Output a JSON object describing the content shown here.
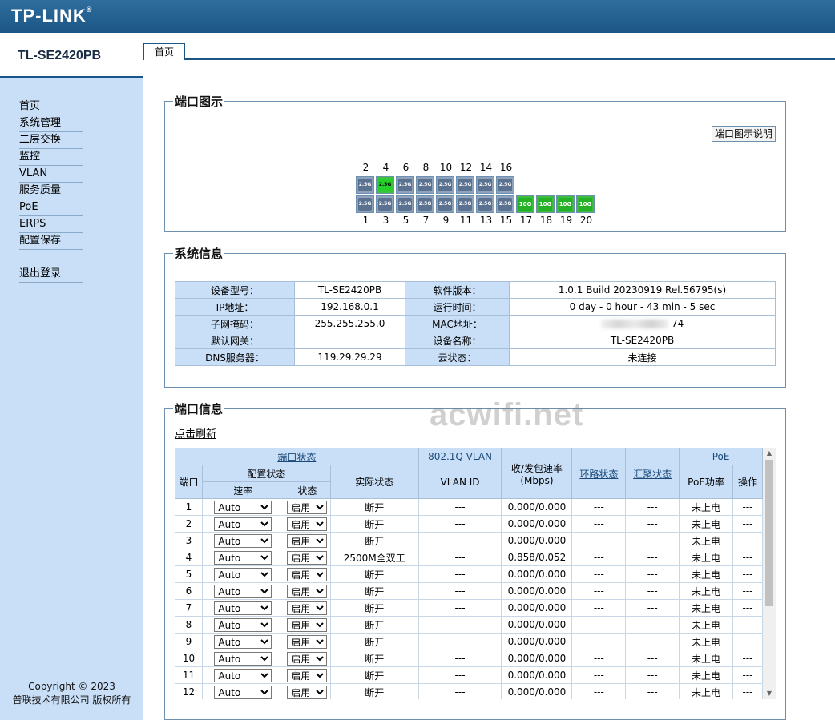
{
  "brand": {
    "logo": "TP-LINK",
    "trademark": "®"
  },
  "sidebar": {
    "model": "TL-SE2420PB",
    "items": [
      {
        "label": "首页"
      },
      {
        "label": "系统管理"
      },
      {
        "label": "二层交换"
      },
      {
        "label": "监控"
      },
      {
        "label": "VLAN"
      },
      {
        "label": "服务质量"
      },
      {
        "label": "PoE"
      },
      {
        "label": "ERPS"
      },
      {
        "label": "配置保存"
      }
    ],
    "logout": "退出登录",
    "copyright_line1": "Copyright © 2023",
    "copyright_line2": "普联技术有限公司 版权所有"
  },
  "tab": {
    "label": "首页"
  },
  "ports_panel": {
    "title": "端口图示",
    "legend_button": "端口图示说明",
    "top_numbers": [
      "2",
      "4",
      "6",
      "8",
      "10",
      "12",
      "14",
      "16"
    ],
    "bottom_numbers": [
      "1",
      "3",
      "5",
      "7",
      "9",
      "11",
      "13",
      "15",
      "17",
      "18",
      "19",
      "20"
    ],
    "rj45_label": "2.5G",
    "sfp_label": "10G",
    "linked_ports": [
      "4",
      "17",
      "18",
      "19",
      "20"
    ]
  },
  "sysinfo": {
    "title": "系统信息",
    "rows": [
      {
        "k1": "设备型号：",
        "v1": "TL-SE2420PB",
        "k2": "软件版本：",
        "v2": "1.0.1 Build 20230919 Rel.56795(s)"
      },
      {
        "k1": "IP地址：",
        "v1": "192.168.0.1",
        "k2": "运行时间：",
        "v2": "0 day - 0 hour - 43 min - 5 sec"
      },
      {
        "k1": "子网掩码：",
        "v1": "255.255.255.0",
        "k2": "MAC地址：",
        "v2": "-74"
      },
      {
        "k1": "默认网关：",
        "v1": "",
        "k2": "设备名称：",
        "v2": "TL-SE2420PB"
      },
      {
        "k1": "DNS服务器：",
        "v1": "119.29.29.29",
        "k2": "云状态：",
        "v2": "未连接"
      }
    ]
  },
  "portinfo": {
    "title": "端口信息",
    "refresh": "点击刷新",
    "headers": {
      "port_status": "端口状态",
      "dot1q": "802.1Q VLAN",
      "rate": "收/发包速率",
      "rate_unit": "(Mbps)",
      "loop": "环路状态",
      "lag": "汇聚状态",
      "poe": "PoE",
      "port": "端口",
      "config_status": "配置状态",
      "actual_status": "实际状态",
      "vlan_id": "VLAN ID",
      "poe_power": "PoE功率",
      "action": "操作",
      "speed": "速率",
      "state": "状态"
    },
    "rows": [
      {
        "port": "1",
        "speed": "Auto",
        "state": "启用",
        "actual": "断开",
        "vlan": "---",
        "rate": "0.000/0.000",
        "loop": "---",
        "lag": "---",
        "poe": "未上电",
        "op": "---"
      },
      {
        "port": "2",
        "speed": "Auto",
        "state": "启用",
        "actual": "断开",
        "vlan": "---",
        "rate": "0.000/0.000",
        "loop": "---",
        "lag": "---",
        "poe": "未上电",
        "op": "---"
      },
      {
        "port": "3",
        "speed": "Auto",
        "state": "启用",
        "actual": "断开",
        "vlan": "---",
        "rate": "0.000/0.000",
        "loop": "---",
        "lag": "---",
        "poe": "未上电",
        "op": "---"
      },
      {
        "port": "4",
        "speed": "Auto",
        "state": "启用",
        "actual": "2500M全双工",
        "vlan": "---",
        "rate": "0.858/0.052",
        "loop": "---",
        "lag": "---",
        "poe": "未上电",
        "op": "---"
      },
      {
        "port": "5",
        "speed": "Auto",
        "state": "启用",
        "actual": "断开",
        "vlan": "---",
        "rate": "0.000/0.000",
        "loop": "---",
        "lag": "---",
        "poe": "未上电",
        "op": "---"
      },
      {
        "port": "6",
        "speed": "Auto",
        "state": "启用",
        "actual": "断开",
        "vlan": "---",
        "rate": "0.000/0.000",
        "loop": "---",
        "lag": "---",
        "poe": "未上电",
        "op": "---"
      },
      {
        "port": "7",
        "speed": "Auto",
        "state": "启用",
        "actual": "断开",
        "vlan": "---",
        "rate": "0.000/0.000",
        "loop": "---",
        "lag": "---",
        "poe": "未上电",
        "op": "---"
      },
      {
        "port": "8",
        "speed": "Auto",
        "state": "启用",
        "actual": "断开",
        "vlan": "---",
        "rate": "0.000/0.000",
        "loop": "---",
        "lag": "---",
        "poe": "未上电",
        "op": "---"
      },
      {
        "port": "9",
        "speed": "Auto",
        "state": "启用",
        "actual": "断开",
        "vlan": "---",
        "rate": "0.000/0.000",
        "loop": "---",
        "lag": "---",
        "poe": "未上电",
        "op": "---"
      },
      {
        "port": "10",
        "speed": "Auto",
        "state": "启用",
        "actual": "断开",
        "vlan": "---",
        "rate": "0.000/0.000",
        "loop": "---",
        "lag": "---",
        "poe": "未上电",
        "op": "---"
      },
      {
        "port": "11",
        "speed": "Auto",
        "state": "启用",
        "actual": "断开",
        "vlan": "---",
        "rate": "0.000/0.000",
        "loop": "---",
        "lag": "---",
        "poe": "未上电",
        "op": "---"
      },
      {
        "port": "12",
        "speed": "Auto",
        "state": "启用",
        "actual": "断开",
        "vlan": "---",
        "rate": "0.000/0.000",
        "loop": "---",
        "lag": "---",
        "poe": "未上电",
        "op": "---"
      }
    ]
  },
  "watermark": "acwifi.net",
  "colors": {
    "header": "#1b5585",
    "sidebar": "#c9dff7",
    "link_up": "#23d12a"
  }
}
